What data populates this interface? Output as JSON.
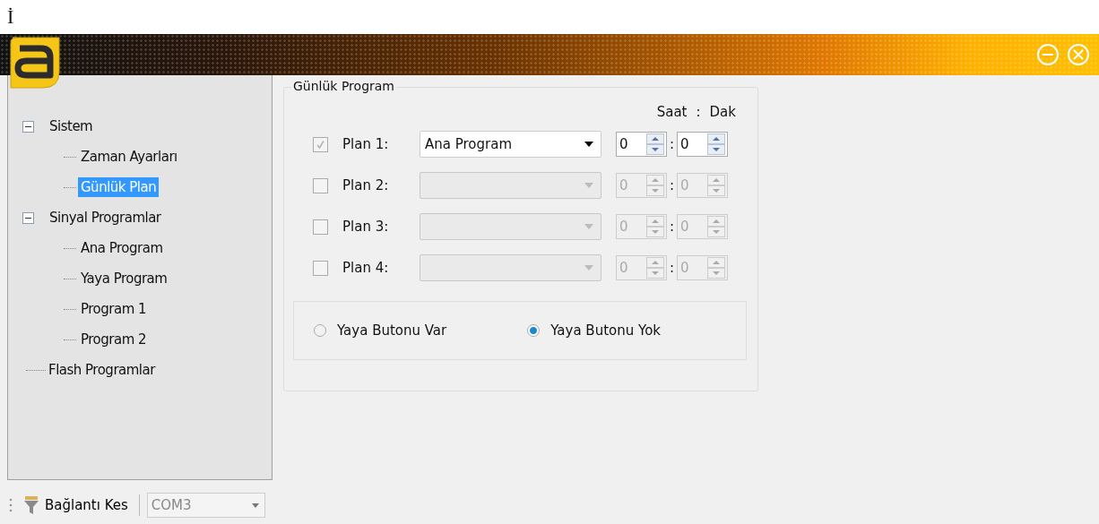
{
  "top_text": "İ",
  "tree": [
    {
      "label": "Sistem",
      "expanded": true,
      "selected": false,
      "children": [
        {
          "label": "Zaman Ayarları",
          "selected": false
        },
        {
          "label": "Günlük Plan",
          "selected": true
        }
      ]
    },
    {
      "label": "Sinyal Programlar",
      "expanded": true,
      "selected": false,
      "children": [
        {
          "label": "Ana Program",
          "selected": false
        },
        {
          "label": "Yaya Program",
          "selected": false
        },
        {
          "label": "Program 1",
          "selected": false
        },
        {
          "label": "Program 2",
          "selected": false
        }
      ]
    },
    {
      "label": "Flash Programlar",
      "selected": false
    }
  ],
  "group": {
    "title": "Günlük Program",
    "hour_label": "Saat",
    "separator": ":",
    "minute_label": "Dak",
    "plans": [
      {
        "label": "Plan 1:",
        "checked": true,
        "disabled": false,
        "program": "Ana Program",
        "hour": "0",
        "minute": "0"
      },
      {
        "label": "Plan 2:",
        "checked": false,
        "disabled": true,
        "hour": "0",
        "minute": "0"
      },
      {
        "label": "Plan 3:",
        "checked": false,
        "disabled": true,
        "hour": "0",
        "minute": "0"
      },
      {
        "label": "Plan 4:",
        "checked": false,
        "disabled": true,
        "hour": "0",
        "minute": "0"
      }
    ],
    "radios": [
      {
        "label": "Yaya Butonu Var",
        "selected": false
      },
      {
        "label": "Yaya Butonu Yok",
        "selected": true
      }
    ]
  },
  "toolbar": {
    "disconnect": "Bağlantı Kes",
    "port": "COM3"
  }
}
